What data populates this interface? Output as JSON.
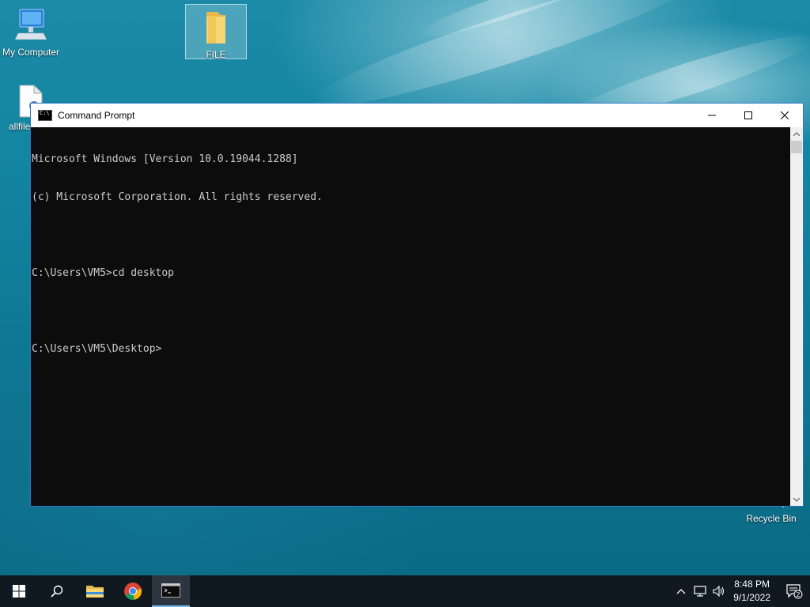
{
  "desktop": {
    "icons": [
      {
        "label": "My Computer"
      },
      {
        "label": "FILE"
      },
      {
        "label": "allfile"
      },
      {
        "label": "Recycle Bin"
      }
    ]
  },
  "window": {
    "title": "Command Prompt",
    "buttons": {
      "minimize": "—",
      "maximize": "☐",
      "close": "✕"
    },
    "console_lines": [
      "Microsoft Windows [Version 10.0.19044.1288]",
      "(c) Microsoft Corporation. All rights reserved.",
      "",
      "C:\\Users\\VM5>cd desktop",
      "",
      "C:\\Users\\VM5\\Desktop>"
    ]
  },
  "taskbar": {
    "items": [
      {
        "name": "start",
        "icon": "windows-logo-icon"
      },
      {
        "name": "search",
        "icon": "search-icon"
      },
      {
        "name": "file-explorer",
        "icon": "folder-icon"
      },
      {
        "name": "chrome",
        "icon": "chrome-icon"
      },
      {
        "name": "command-prompt",
        "icon": "terminal-icon",
        "active": true
      }
    ],
    "tray": {
      "chevron": "^",
      "time": "8:48 PM",
      "date": "9/1/2022",
      "notification_count": "2"
    }
  },
  "colors": {
    "taskbar_bg": "#101820",
    "console_bg": "#0c0c0c",
    "console_fg": "#cccccc",
    "window_border": "#2b79c9"
  }
}
